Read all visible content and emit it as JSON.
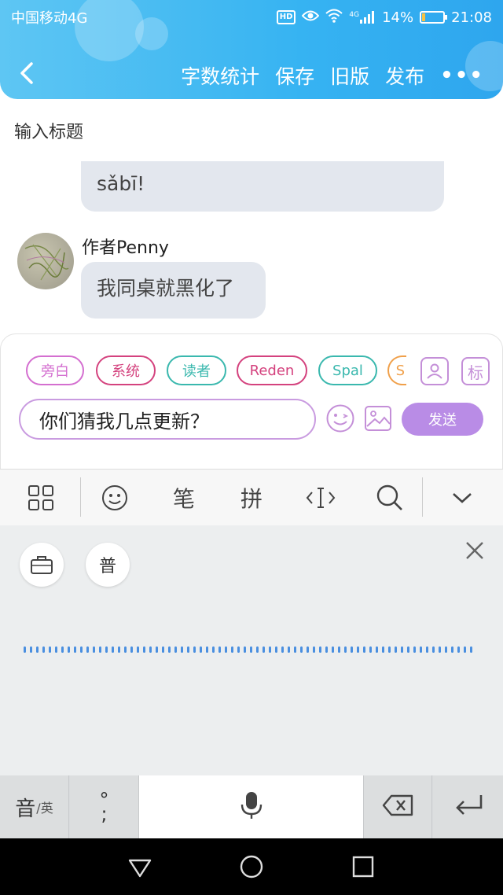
{
  "status_bar": {
    "carrier": "中国移动4G",
    "hd_badge": "HD",
    "network": "4G",
    "battery": "14%",
    "battery_level": 0.14,
    "time": "21:08"
  },
  "header": {
    "actions": [
      "字数统计",
      "保存",
      "旧版",
      "发布"
    ],
    "more": "•••"
  },
  "title_placeholder": "输入标题",
  "chat": {
    "prev_message_tail": "sǎbī!",
    "author_name": "作者Penny",
    "author_message": "我同桌就黑化了"
  },
  "composer": {
    "chips": [
      "旁白",
      "系统",
      "读者",
      "Reden",
      "Spal",
      "S"
    ],
    "chip_colors": [
      "#d46fd0",
      "#d4427e",
      "#3ab8ae",
      "#d4427e",
      "#3ab8ae",
      "#f0a04a"
    ],
    "tag_button": "标",
    "input_value": "你们猜我几点更新？",
    "send_label": "发送",
    "accent_color": "#b98ce6"
  },
  "ime_toolbar": {
    "handwriting": "笔",
    "pinyin": "拼"
  },
  "voice_panel": {
    "voice_key": "普"
  },
  "keyboard": {
    "lang_main": "音",
    "lang_sub": "/英",
    "punct_top": "°",
    "punct_bottom": ";"
  }
}
